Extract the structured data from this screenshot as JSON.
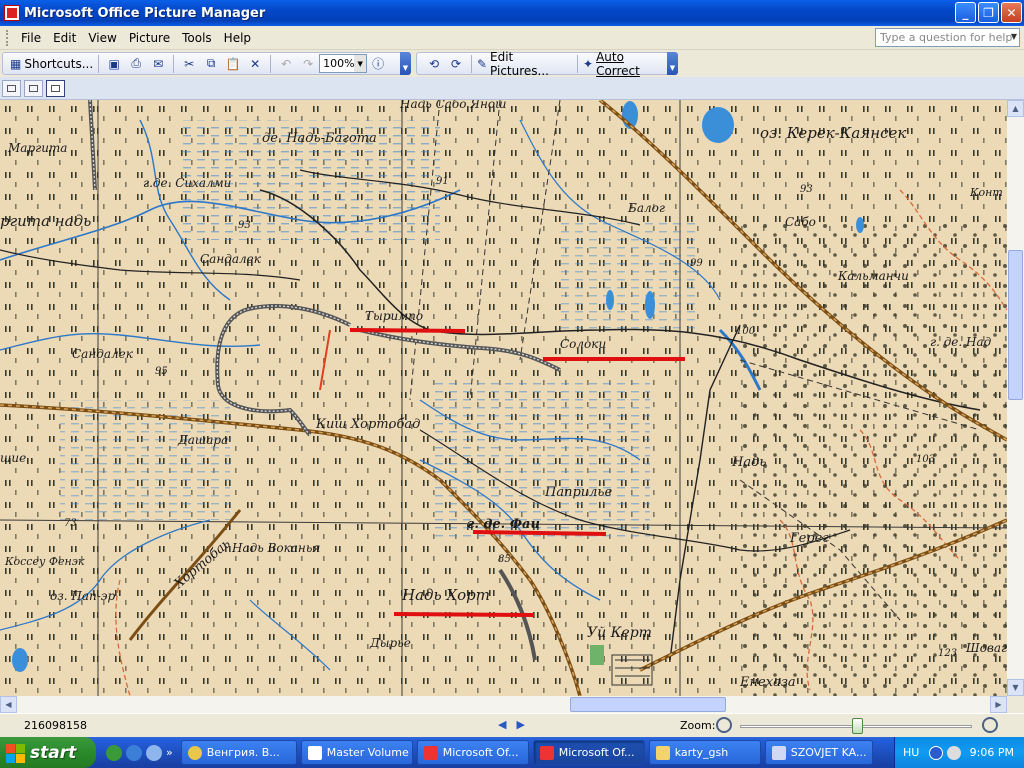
{
  "window": {
    "title": "Microsoft Office Picture Manager",
    "minimize": "_",
    "restore": "❐",
    "close": "✕"
  },
  "menu": {
    "items": [
      "File",
      "Edit",
      "View",
      "Picture",
      "Tools",
      "Help"
    ],
    "help_placeholder": "Type a question for help"
  },
  "toolbar": {
    "shortcuts_label": "Shortcuts...",
    "zoom_value": "100%",
    "edit_pictures_label": "Edit Pictures...",
    "auto_correct_label": "Auto Correct"
  },
  "map": {
    "labels": {
      "nad_sabo_ya": "Надь Сабо Янош",
      "oz_kerek": "оз. Керек-Каянсек",
      "margita": "Маргита",
      "de_nad_bagota": "де. Надь-Багота",
      "gde_sihalmi": "г.де. Сихалми",
      "h91": "91",
      "margita_nad": "ргита надь",
      "balog": "Балог",
      "sabo": "Сабо",
      "kont": "Конт",
      "h93a": "93",
      "h93b": "93",
      "sandalek1": "Сандалек",
      "h99": "99",
      "kalmanchi": "Кальманчи",
      "tyrimpo": "Тыримпо",
      "h100": "100",
      "soloki": "Солоки",
      "gde_nad": "г. де. Над",
      "sandalek2": "Сандалек",
      "h95": "95",
      "kish_hortobad": "Киш Хортобад",
      "dashara": "Дашара",
      "nad": "Надь",
      "she": "шие",
      "h103": "103",
      "paprilye": "Паприлье",
      "h73": "73",
      "gde_fai": "г. де. Фаи",
      "gereg": "Герег",
      "hortobaj": "Хортобаь",
      "nad_vokanya": "Надь Воканья",
      "h85": "85",
      "kossev_fenek": "Коссеу Фенэк",
      "oz_pap": "оз. Пап-эр",
      "nad_hort": "Надь Хорт",
      "dyrye": "Дырье",
      "ui_kert": "Уй Керт",
      "h123": "123",
      "shovag": "Шоваг",
      "enehaza": "Енехаза"
    }
  },
  "status": {
    "image_id": "216098158",
    "zoom_label": "Zoom:"
  },
  "taskbar": {
    "start_label": "start",
    "tasks": [
      {
        "label": "Венгрия. В...",
        "active": false
      },
      {
        "label": "Master Volume",
        "active": false
      },
      {
        "label": "Microsoft Of...",
        "active": false
      },
      {
        "label": "Microsoft Of...",
        "active": true
      },
      {
        "label": "karty_gsh",
        "active": false
      },
      {
        "label": "SZOVJET KA...",
        "active": false
      }
    ],
    "lang": "HU",
    "time": "9:06 PM"
  },
  "colors": {
    "map_bg": "#ecd9b6",
    "water": "#2b78c9",
    "road": "#b7791f",
    "annotation": "#e01010"
  }
}
